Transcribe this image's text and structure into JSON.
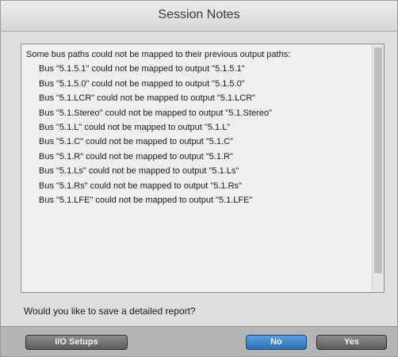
{
  "dialog": {
    "title": "Session Notes",
    "header_line": "Some bus paths could not be mapped to their previous output paths:",
    "lines": [
      "Bus \"5.1.5.1\" could not be mapped to output \"5.1.5.1\"",
      "Bus \"5.1.5.0\" could not be mapped to output \"5.1.5.0\"",
      "Bus \"5.1.LCR\" could not be mapped to output \"5.1.LCR\"",
      "Bus \"5.1.Stereo\" could not be mapped to output \"5.1.Stereo\"",
      "Bus \"5.1.L\" could not be mapped to output \"5.1.L\"",
      "Bus \"5.1.C\" could not be mapped to output \"5.1.C\"",
      "Bus \"5.1.R\" could not be mapped to output \"5.1.R\"",
      "Bus \"5.1.Ls\" could not be mapped to output \"5.1.Ls\"",
      "Bus \"5.1.Rs\" could not be mapped to output \"5.1.Rs\"",
      "Bus \"5.1.LFE\" could not be mapped to output \"5.1.LFE\""
    ],
    "prompt": "Would you like to save a detailed report?",
    "buttons": {
      "io_setups": "I/O Setups",
      "no": "No",
      "yes": "Yes"
    }
  },
  "colors": {
    "default_button": "#2f6fb3",
    "button": "#5a5a5a",
    "window_background": "#dedede"
  }
}
